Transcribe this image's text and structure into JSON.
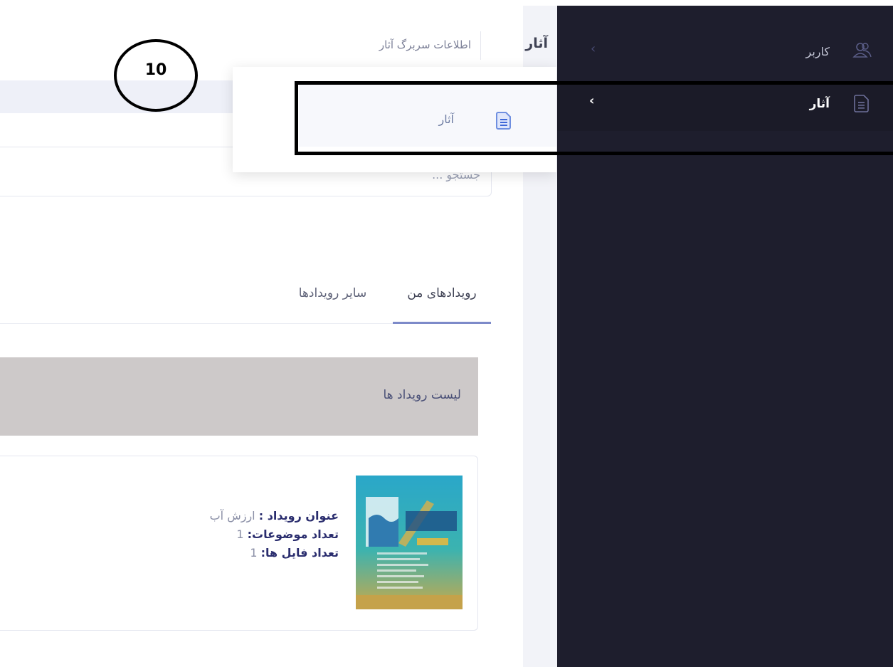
{
  "header": {
    "title": "آثار",
    "subtitle": "اطلاعات سربرگ آثار"
  },
  "search": {
    "placeholder": "جستجو ..."
  },
  "tabs": [
    {
      "label": "رویدادهای من",
      "active": true
    },
    {
      "label": "سایر رویدادها",
      "active": false
    }
  ],
  "list": {
    "title": "لیست رویداد ها"
  },
  "event": {
    "title_label": "عنوان رویداد :",
    "title_value": "ارزش آب",
    "topics_label": "تعداد موضوعات:",
    "topics_value": "1",
    "files_label": "تعداد فایل ها:",
    "files_value": "1"
  },
  "dropdown": {
    "item_label": "آثار",
    "item_icon": "document-icon"
  },
  "sidebar": {
    "items": [
      {
        "label": "کاربر",
        "icon": "users-icon",
        "active": false
      },
      {
        "label": "آثار",
        "icon": "document-icon",
        "active": true
      }
    ]
  },
  "annotation": {
    "number": "10"
  },
  "colors": {
    "sidebar_bg": "#1e1e2d",
    "accent": "#7d8ac9",
    "list_header_bg": "#cdc9c9"
  }
}
